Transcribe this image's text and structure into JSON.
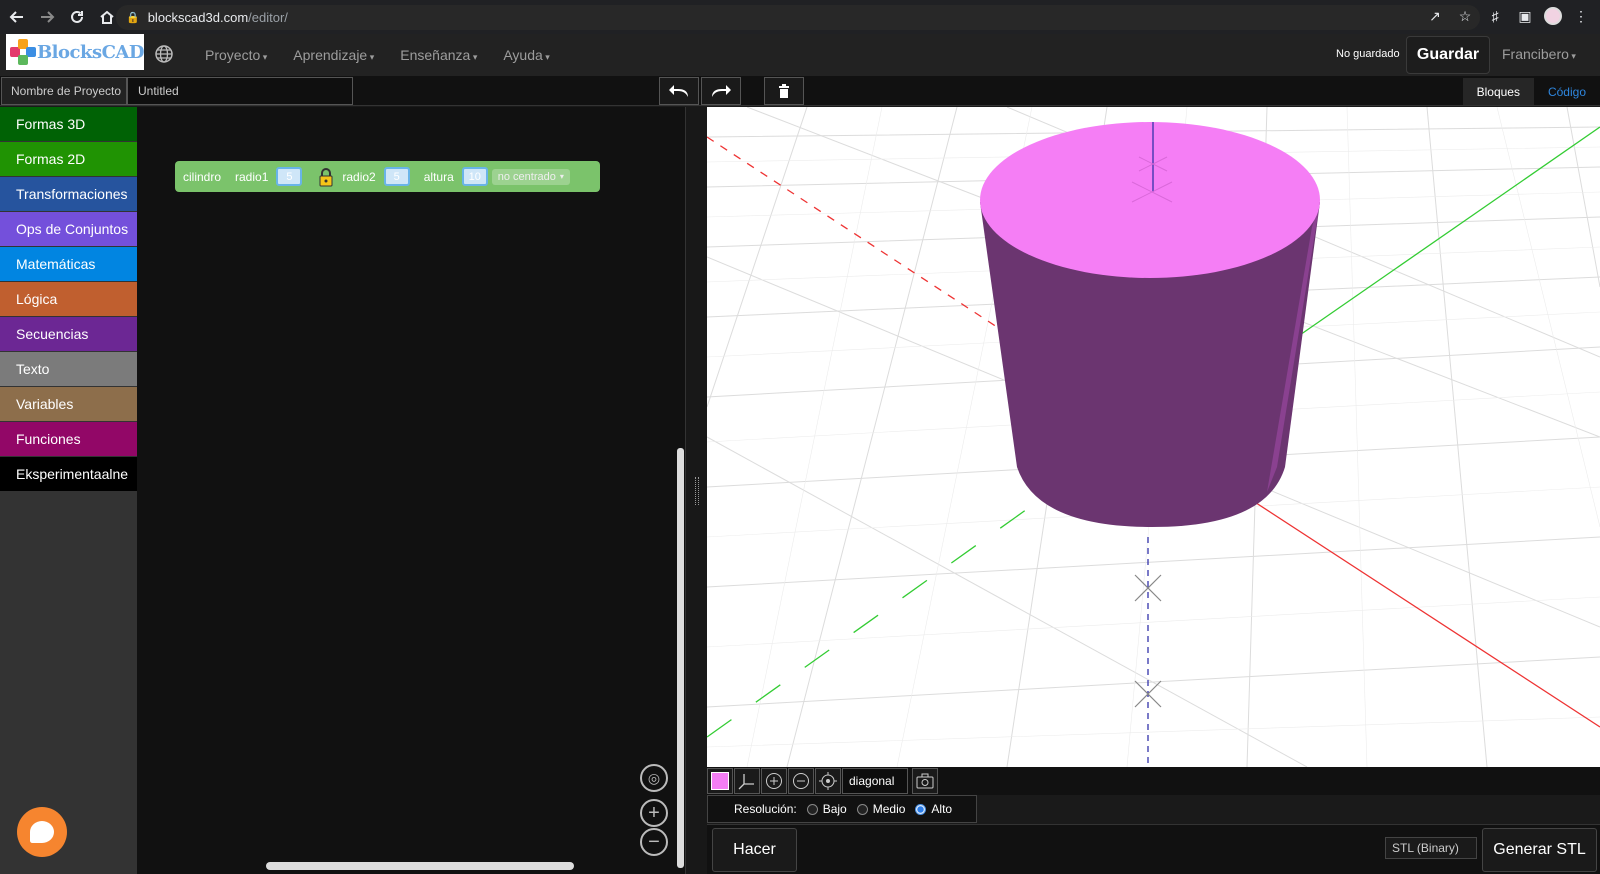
{
  "browser": {
    "url_domain": "blockscad3d.com",
    "url_path": "/editor/"
  },
  "app": {
    "logo_text": "BlocksCAD",
    "menu": [
      "Proyecto",
      "Aprendizaje",
      "Enseñanza",
      "Ayuda"
    ],
    "save_status": "No guardado",
    "save_label": "Guardar",
    "user": "Francibero"
  },
  "project": {
    "name_label": "Nombre de Proyecto",
    "name_value": "Untitled"
  },
  "view_tabs": {
    "blocks": "Bloques",
    "code": "Código"
  },
  "sidebar": {
    "categories": [
      {
        "label": "Formas 3D",
        "color": "#006205"
      },
      {
        "label": "Formas 2D",
        "color": "#209303"
      },
      {
        "label": "Transformaciones",
        "color": "#26549e"
      },
      {
        "label": "Ops de Conjuntos",
        "color": "#7450db"
      },
      {
        "label": "Matemáticas",
        "color": "#0185e1"
      },
      {
        "label": "Lógica",
        "color": "#c05f2f"
      },
      {
        "label": "Secuencias",
        "color": "#6c2794"
      },
      {
        "label": "Texto",
        "color": "#7b7b7b"
      },
      {
        "label": "Variables",
        "color": "#8d6e4b"
      },
      {
        "label": "Funciones",
        "color": "#920767"
      },
      {
        "label": "Eksperimentaalne",
        "color": "#000000"
      }
    ]
  },
  "block": {
    "name": "cilindro",
    "radio1_label": "radio1",
    "radio1_value": "5",
    "radio2_label": "radio2",
    "radio2_value": "5",
    "height_label": "altura",
    "height_value": "10",
    "center_option": "no centrado"
  },
  "viewer": {
    "object_color": "#f57ef5",
    "view_mode": "diagonal",
    "resolution_label": "Resolución:",
    "resolution_options": [
      "Bajo",
      "Medio",
      "Alto"
    ],
    "resolution_selected": "Alto",
    "render_label": "Hacer",
    "export_format": "STL (Binary)",
    "export_label": "Generar STL"
  }
}
